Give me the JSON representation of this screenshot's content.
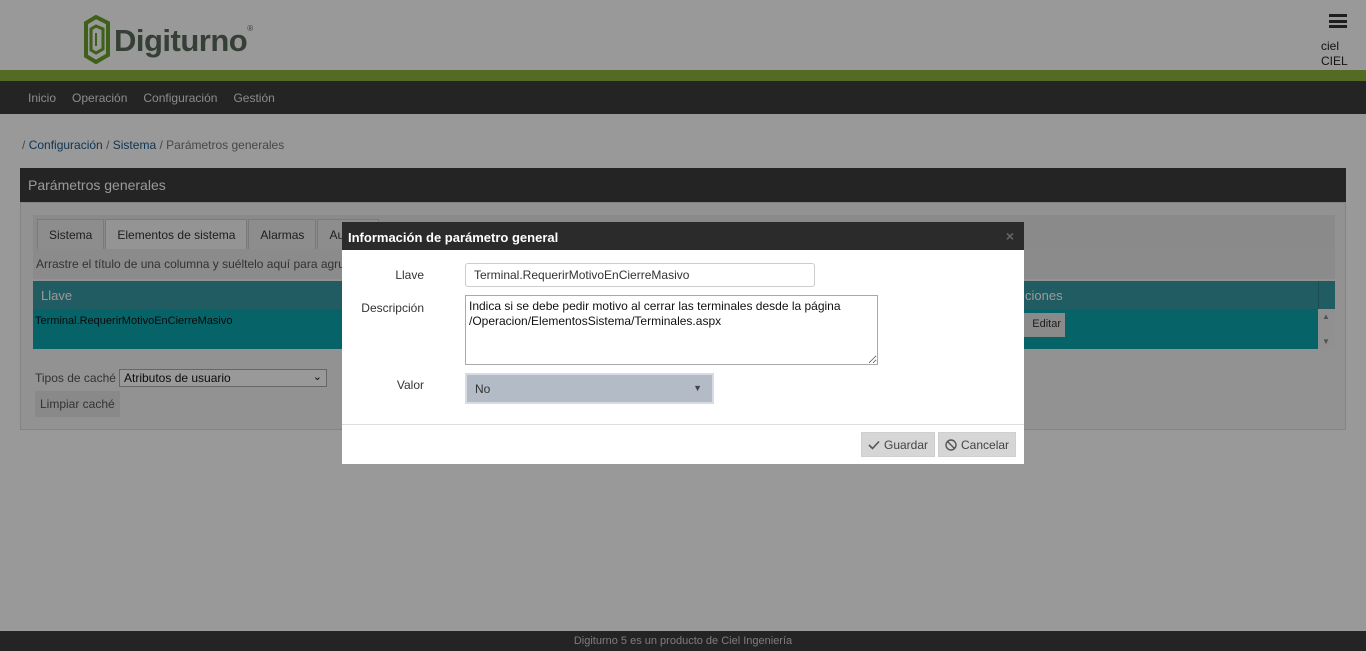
{
  "app": {
    "logo_text": "Digiturno",
    "logo_mark": "®",
    "user_name": "ciel",
    "user_org": "CIEL"
  },
  "nav": {
    "items": [
      "Inicio",
      "Operación",
      "Configuración",
      "Gestión"
    ]
  },
  "breadcrumb": {
    "sep": "/",
    "items": [
      "Configuración",
      "Sistema",
      "Parámetros generales"
    ]
  },
  "panel": {
    "title": "Parámetros generales",
    "tabs": [
      "Sistema",
      "Elementos de sistema",
      "Alarmas",
      "Autenti"
    ],
    "group_hint": "Arrastre el título de una columna y suéltelo aquí para agrupar",
    "grid": {
      "columns": [
        "Llave",
        "Acciones"
      ],
      "acciones_visible": "ciones",
      "rows": [
        {
          "llave": "Terminal.RequerirMotivoEnCierreMasivo",
          "action": "Editar"
        }
      ]
    },
    "cache_label": "Tipos de caché",
    "cache_selected": "Atributos de usuario",
    "clear_cache": "Limpiar caché"
  },
  "modal": {
    "title": "Información de parámetro general",
    "close": "×",
    "llave_label": "Llave",
    "llave_value": "Terminal.RequerirMotivoEnCierreMasivo",
    "descripcion_label": "Descripción",
    "descripcion_value": "Indica si se debe pedir motivo al cerrar las terminales desde la página /Operacion/ElementosSistema/Terminales.aspx",
    "valor_label": "Valor",
    "valor_selected": "No",
    "save": "Guardar",
    "cancel": "Cancelar"
  },
  "footer": {
    "text": "Digiturno 5 es un producto de Ciel Ingeniería"
  },
  "colors": {
    "brand_green": "#8bb33a",
    "dark": "#3c3c3c",
    "grid_header": "#3a9aa6",
    "grid_selected": "#0aa6ac"
  }
}
